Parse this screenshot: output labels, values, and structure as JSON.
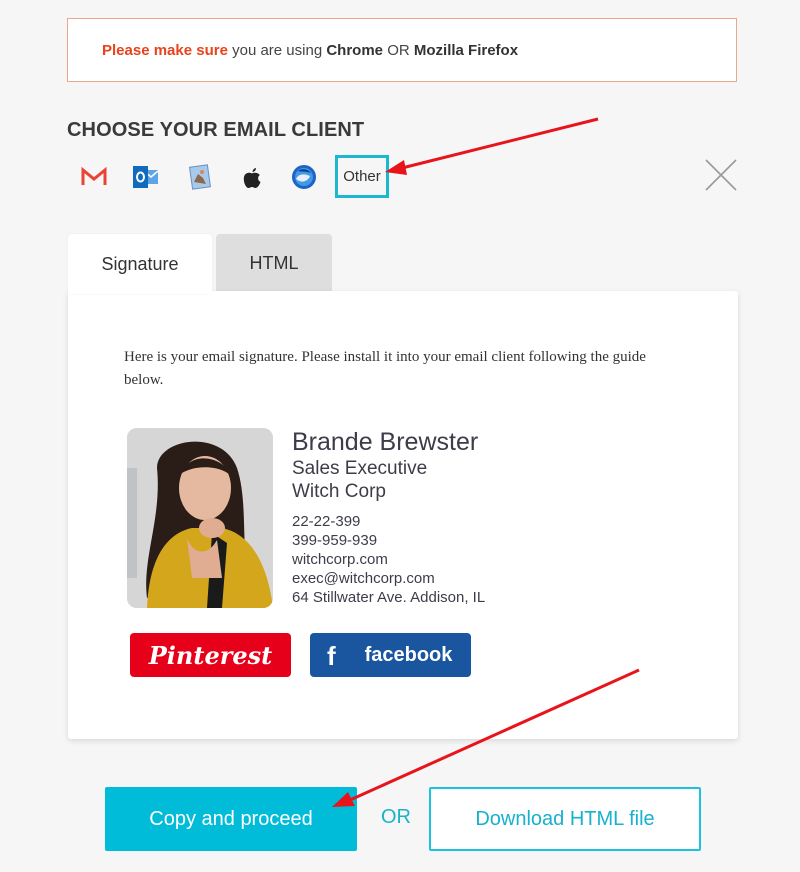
{
  "notice": {
    "warning": "Please make sure",
    "text_1": " you are using ",
    "browser_1": "Chrome",
    "text_2": " OR ",
    "browser_2": "Mozilla Firefox"
  },
  "heading": "CHOOSE YOUR EMAIL CLIENT",
  "clients": [
    {
      "name": "Gmail",
      "icon": "gmail-icon"
    },
    {
      "name": "Outlook",
      "icon": "outlook-icon"
    },
    {
      "name": "Apple Mail (macOS)",
      "icon": "apple-mail-icon"
    },
    {
      "name": "Apple",
      "icon": "apple-icon"
    },
    {
      "name": "Thunderbird",
      "icon": "thunderbird-icon"
    }
  ],
  "other_label": "Other",
  "tabs": [
    {
      "label": "Signature",
      "active": true
    },
    {
      "label": "HTML",
      "active": false
    }
  ],
  "panel": {
    "intro": "Here is your email signature. Please install it into your email client following the guide below."
  },
  "signature": {
    "name": "Brande Brewster",
    "title": "Sales Executive",
    "company": "Witch Corp",
    "phone_1": "22-22-399",
    "phone_2": "399-959-939",
    "website": "witchcorp.com",
    "email": "exec@witchcorp.com",
    "address": "64 Stillwater Ave. Addison, IL"
  },
  "social": {
    "pinterest": "Pinterest",
    "facebook_icon": "f",
    "facebook": "facebook"
  },
  "actions": {
    "copy": "Copy and proceed",
    "or": "OR",
    "download": "Download HTML file"
  },
  "colors": {
    "accent": "#00bcd9",
    "warning": "#e8431c",
    "pinterest": "#e60019",
    "facebook": "#1a55a0",
    "annotation_arrow": "#e8141b"
  }
}
